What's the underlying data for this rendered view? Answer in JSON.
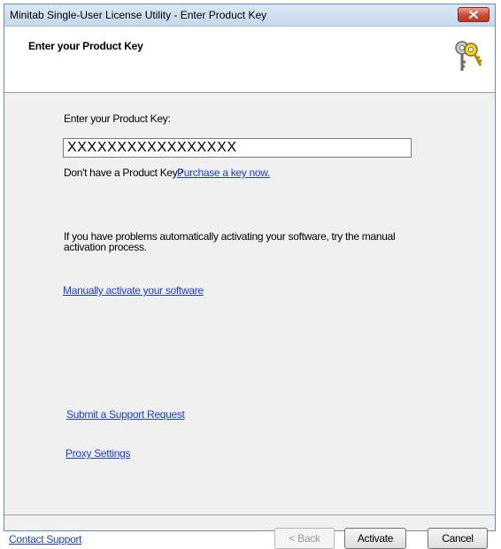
{
  "window": {
    "title": "Minitab Single-User License Utility - Enter Product Key"
  },
  "header": {
    "title": "Enter your Product Key"
  },
  "form": {
    "key_label": "Enter your Product Key:",
    "key_value": "XXXXXXXXXXXXXXXXX",
    "no_key_text": "Don't have a Product Key?",
    "purchase_link": "Purchase a key now.",
    "problems_line1": "If you have problems automatically activating your software, try the manual",
    "problems_line2": "activation process.",
    "manual_link": "Manually activate your software",
    "support_request_link": "Submit a Support Request",
    "proxy_link": "Proxy Settings"
  },
  "footer": {
    "contact_link": "Contact Support",
    "back_label": "< Back",
    "activate_label": "Activate",
    "cancel_label": "Cancel"
  },
  "colors": {
    "link": "#1a3fd0",
    "close_button": "#c94a34",
    "panel_background": "#f0f0f0"
  }
}
